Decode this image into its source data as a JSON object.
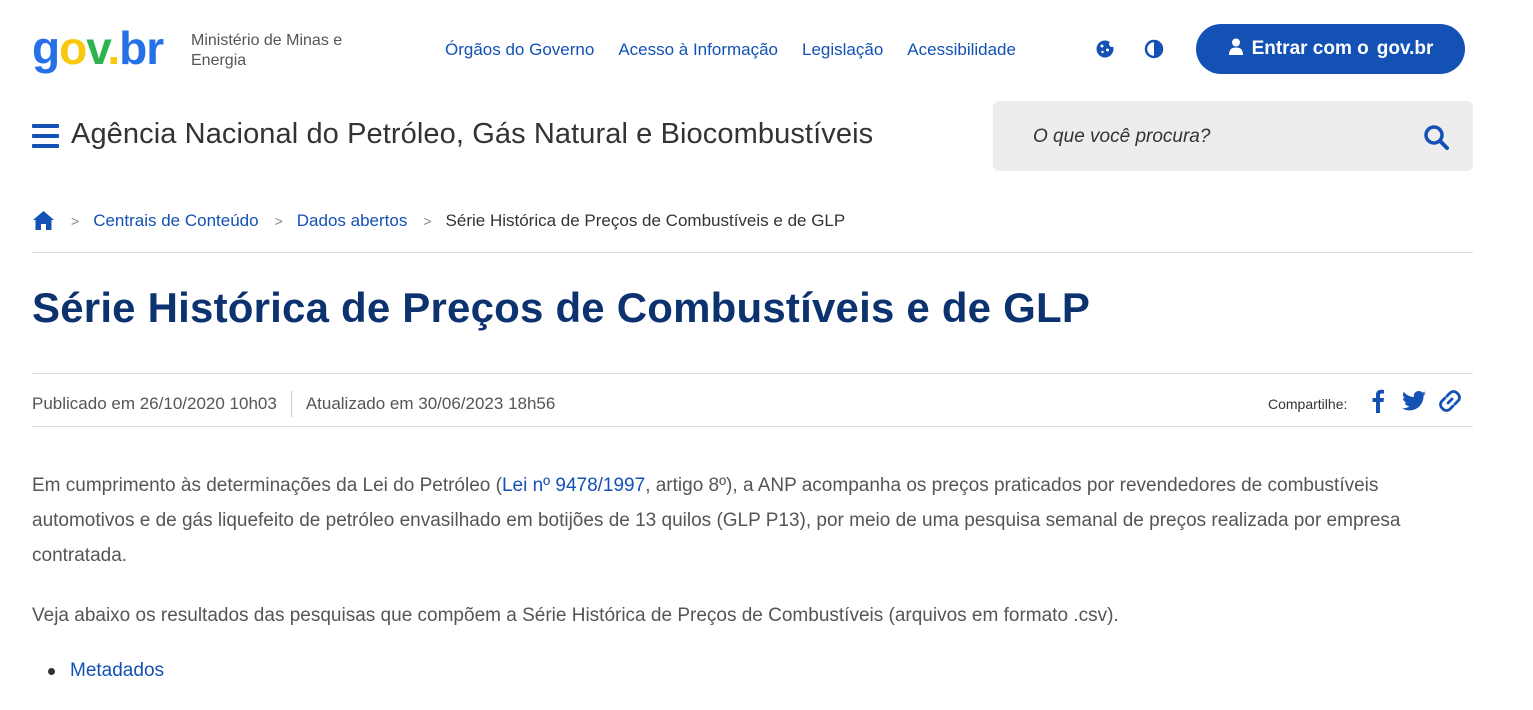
{
  "header": {
    "logo_text": "gov.br",
    "ministry": "Ministério de Minas e Energia",
    "nav": [
      "Órgãos do Governo",
      "Acesso à Informação",
      "Legislação",
      "Acessibilidade"
    ],
    "icons": [
      "cookie-icon",
      "contrast-icon"
    ],
    "login_prefix": "Entrar com o",
    "login_brand": "gov.br",
    "brand_color": "#1351b4"
  },
  "site": {
    "title": "Agência Nacional do Petróleo, Gás Natural e Biocombustíveis",
    "search_placeholder": "O que você procura?"
  },
  "breadcrumb": {
    "items": [
      "Centrais de Conteúdo",
      "Dados abertos"
    ],
    "current": "Série Histórica de Preços de Combustíveis e de GLP"
  },
  "page": {
    "title": "Série Histórica de Preços de Combustíveis e de GLP",
    "published": "Publicado em 26/10/2020 10h03",
    "updated": "Atualizado em 30/06/2023 18h56",
    "share_label": "Compartilhe:",
    "share_icons": [
      "facebook-icon",
      "twitter-icon",
      "link-icon"
    ],
    "title_color": "#0c326f"
  },
  "content": {
    "p1_before": "Em cumprimento às determinações da Lei do Petróleo (",
    "p1_link": "Lei nº 9478/1997",
    "p1_after": ", artigo 8º), a ANP acompanha os preços praticados por revendedores de combustíveis automotivos e de gás liquefeito de petróleo envasilhado em botijões de 13 quilos (GLP P13), por meio de uma pesquisa semanal de preços realizada por empresa contratada.",
    "p2": "Veja abaixo os resultados das pesquisas que compõem a Série Histórica de Preços de Combustíveis (arquivos em formato .csv).",
    "list": [
      "Metadados"
    ]
  }
}
